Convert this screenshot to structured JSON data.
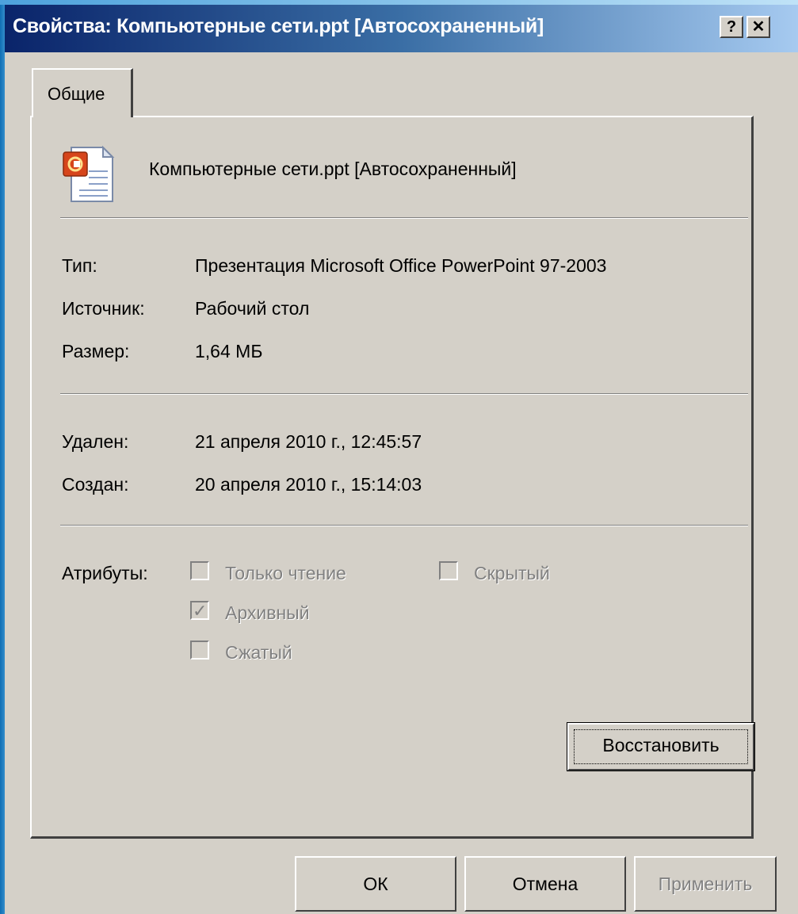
{
  "window": {
    "title": "Свойства: Компьютерные сети.ppt [Автосохраненный]",
    "help_label": "?",
    "close_label": "✕"
  },
  "tabs": [
    {
      "label": "Общие"
    }
  ],
  "file": {
    "name": "Компьютерные сети.ppt [Автосохраненный]",
    "icon": "powerpoint-file-icon"
  },
  "details": [
    {
      "label": "Тип:",
      "value": "Презентация Microsoft Office PowerPoint 97-2003"
    },
    {
      "label": "Источник:",
      "value": "Рабочий стол"
    },
    {
      "label": "Размер:",
      "value": "1,64 МБ"
    }
  ],
  "dates": [
    {
      "label": "Удален:",
      "value": "21 апреля 2010 г., 12:45:57"
    },
    {
      "label": "Создан:",
      "value": "20 апреля 2010 г., 15:14:03"
    }
  ],
  "attributes": {
    "label": "Атрибуты:",
    "items": [
      {
        "label": "Только чтение",
        "checked": false,
        "enabled": false
      },
      {
        "label": "Скрытый",
        "checked": false,
        "enabled": false
      },
      {
        "label": "Архивный",
        "checked": true,
        "enabled": false
      },
      {
        "label": "Сжатый",
        "checked": false,
        "enabled": false
      }
    ]
  },
  "buttons": {
    "restore": "Восстановить",
    "ok": "ОК",
    "cancel": "Отмена",
    "apply": "Применить"
  },
  "colors": {
    "titlebar_start": "#0a246a",
    "titlebar_end": "#a6caf0",
    "face": "#d4d0c8",
    "disabled_text": "#808080"
  }
}
